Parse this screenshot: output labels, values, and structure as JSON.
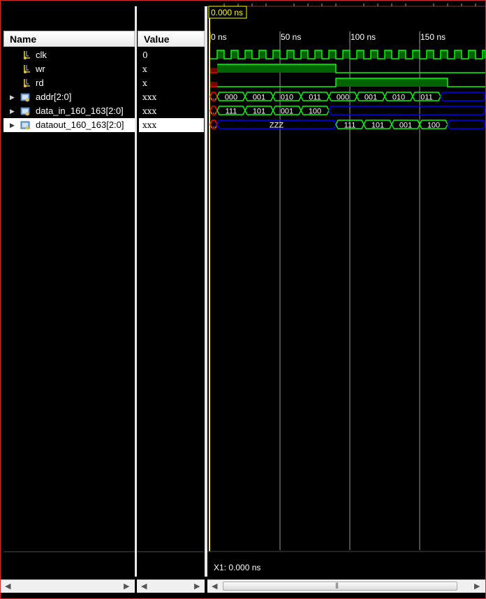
{
  "name_panel": {
    "header": "Name"
  },
  "value_panel": {
    "header": "Value"
  },
  "signals": [
    {
      "name": "clk",
      "value": "0",
      "type": "bit",
      "expandable": false
    },
    {
      "name": "wr",
      "value": "x",
      "type": "bit",
      "expandable": false
    },
    {
      "name": "rd",
      "value": "x",
      "type": "bit",
      "expandable": false
    },
    {
      "name": "addr[2:0]",
      "value": "xxx",
      "type": "bus",
      "expandable": true
    },
    {
      "name": "data_in_160_163[2:0]",
      "value": "xxx",
      "type": "bus",
      "expandable": true
    },
    {
      "name": "dataout_160_163[2:0]",
      "value": "xxx",
      "type": "bus",
      "expandable": true,
      "selected": true
    }
  ],
  "cursor": {
    "time_label": "0.000 ns",
    "color": "#ffff00"
  },
  "time_axis": {
    "labels": [
      "0 ns",
      "50 ns",
      "100 ns",
      "150 ns"
    ],
    "ticks_ns": [
      0,
      50,
      100,
      150
    ],
    "view_start_ns": 0,
    "view_end_ns": 197
  },
  "waves": {
    "clk": {
      "period_ns": 10,
      "high_from_ns": 5
    },
    "wr": {
      "segments": [
        {
          "from_ns": 0,
          "to_ns": 5,
          "state": "x"
        },
        {
          "from_ns": 5,
          "to_ns": 90,
          "state": "1"
        },
        {
          "from_ns": 90,
          "to_ns": 197,
          "state": "0"
        }
      ]
    },
    "rd": {
      "segments": [
        {
          "from_ns": 0,
          "to_ns": 5,
          "state": "x"
        },
        {
          "from_ns": 5,
          "to_ns": 90,
          "state": "0"
        },
        {
          "from_ns": 90,
          "to_ns": 170,
          "state": "1"
        },
        {
          "from_ns": 170,
          "to_ns": 197,
          "state": "0"
        }
      ]
    },
    "addr": {
      "segments": [
        {
          "from_ns": 0,
          "to_ns": 5,
          "label": "...",
          "kind": "x"
        },
        {
          "from_ns": 5,
          "to_ns": 25,
          "label": "000",
          "kind": "val"
        },
        {
          "from_ns": 25,
          "to_ns": 45,
          "label": "001",
          "kind": "val"
        },
        {
          "from_ns": 45,
          "to_ns": 65,
          "label": "010",
          "kind": "val"
        },
        {
          "from_ns": 65,
          "to_ns": 85,
          "label": "011",
          "kind": "val"
        },
        {
          "from_ns": 85,
          "to_ns": 105,
          "label": "000",
          "kind": "val"
        },
        {
          "from_ns": 105,
          "to_ns": 125,
          "label": "001",
          "kind": "val"
        },
        {
          "from_ns": 125,
          "to_ns": 145,
          "label": "010",
          "kind": "val"
        },
        {
          "from_ns": 145,
          "to_ns": 165,
          "label": "011",
          "kind": "val"
        },
        {
          "from_ns": 165,
          "to_ns": 197,
          "label": "",
          "kind": "z"
        }
      ]
    },
    "data_in": {
      "segments": [
        {
          "from_ns": 0,
          "to_ns": 5,
          "label": "...",
          "kind": "x"
        },
        {
          "from_ns": 5,
          "to_ns": 25,
          "label": "111",
          "kind": "val"
        },
        {
          "from_ns": 25,
          "to_ns": 45,
          "label": "101",
          "kind": "val"
        },
        {
          "from_ns": 45,
          "to_ns": 65,
          "label": "001",
          "kind": "val"
        },
        {
          "from_ns": 65,
          "to_ns": 85,
          "label": "100",
          "kind": "val"
        },
        {
          "from_ns": 85,
          "to_ns": 197,
          "label": "",
          "kind": "z"
        }
      ]
    },
    "dataout": {
      "segments": [
        {
          "from_ns": 0,
          "to_ns": 5,
          "label": "...",
          "kind": "x"
        },
        {
          "from_ns": 5,
          "to_ns": 90,
          "label": "ZZZ",
          "kind": "z"
        },
        {
          "from_ns": 90,
          "to_ns": 110,
          "label": "111",
          "kind": "val"
        },
        {
          "from_ns": 110,
          "to_ns": 130,
          "label": "101",
          "kind": "val"
        },
        {
          "from_ns": 130,
          "to_ns": 150,
          "label": "001",
          "kind": "val"
        },
        {
          "from_ns": 150,
          "to_ns": 170,
          "label": "100",
          "kind": "val"
        },
        {
          "from_ns": 170,
          "to_ns": 197,
          "label": "",
          "kind": "z"
        }
      ]
    }
  },
  "status": {
    "cursor_readout": "X1: 0.000 ns"
  },
  "colors": {
    "wave": "#00ff00",
    "wave_fill": "#006400",
    "unknown": "#ff0000",
    "highz": "#0000ff",
    "grid": "#cccccc",
    "background": "#000000"
  }
}
